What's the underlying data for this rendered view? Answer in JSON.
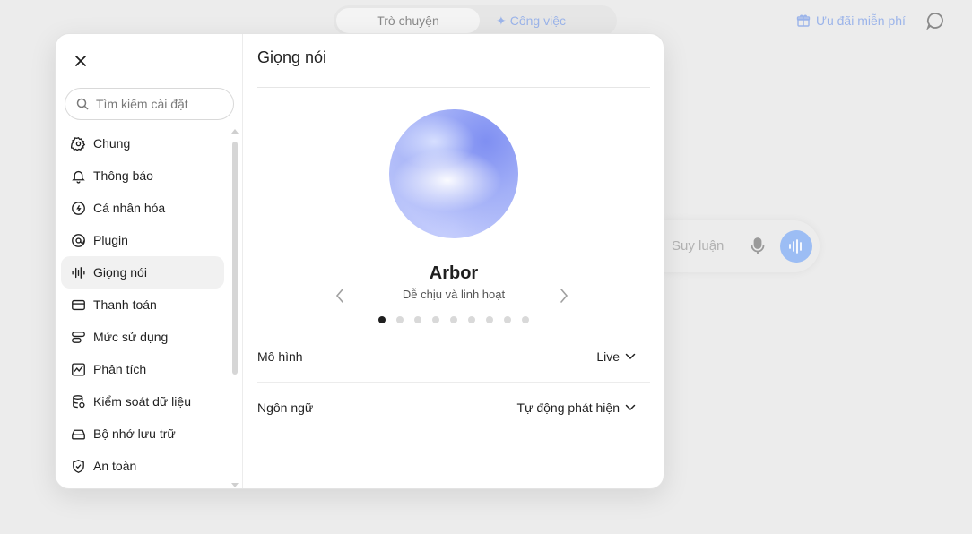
{
  "topbar": {
    "tabs": [
      {
        "label": "Trò chuyện"
      },
      {
        "label": "Công việc"
      }
    ],
    "promo_label": "Ưu đãi miễn phí"
  },
  "composer": {
    "reasoning_label": "Suy luận"
  },
  "settings_modal": {
    "search": {
      "placeholder": "Tìm kiếm cài đặt"
    },
    "nav": [
      {
        "label": "Chung",
        "icon": "gear-icon"
      },
      {
        "label": "Thông báo",
        "icon": "bell-icon"
      },
      {
        "label": "Cá nhân hóa",
        "icon": "personalize-icon"
      },
      {
        "label": "Plugin",
        "icon": "plugin-icon"
      },
      {
        "label": "Giọng nói",
        "icon": "voice-wave-icon"
      },
      {
        "label": "Thanh toán",
        "icon": "card-icon"
      },
      {
        "label": "Mức sử dụng",
        "icon": "usage-icon"
      },
      {
        "label": "Phân tích",
        "icon": "analytics-icon"
      },
      {
        "label": "Kiểm soát dữ liệu",
        "icon": "data-control-icon"
      },
      {
        "label": "Bộ nhớ lưu trữ",
        "icon": "storage-icon"
      },
      {
        "label": "An toàn",
        "icon": "shield-icon"
      }
    ],
    "active_nav": "Giọng nói",
    "content": {
      "title": "Giọng nói",
      "voice": {
        "name": "Arbor",
        "description": "Dễ chịu và linh hoạt",
        "count": 9,
        "selected_index": 0
      },
      "rows": [
        {
          "label": "Mô hình",
          "value": "Live"
        },
        {
          "label": "Ngôn ngữ",
          "value": "Tự động phát hiện"
        }
      ]
    }
  },
  "colors": {
    "accent": "#9cbdf4",
    "promo": "#9bb4ea",
    "orb": "#a3b0f7"
  }
}
